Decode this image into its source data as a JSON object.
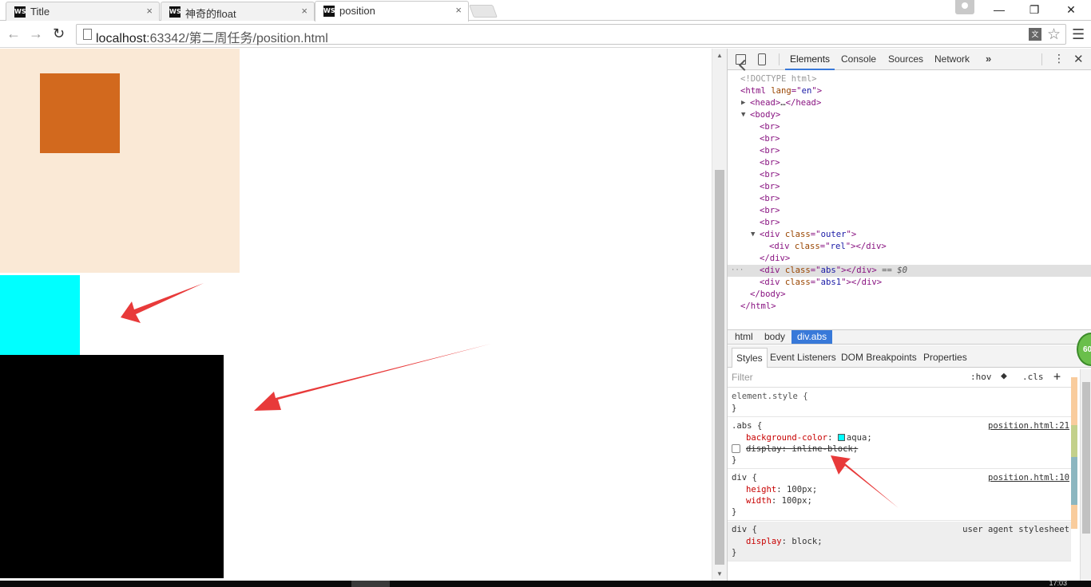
{
  "tabs": [
    {
      "title": "Title",
      "icon": "WS",
      "active": false
    },
    {
      "title": "神奇的float",
      "icon": "WS",
      "active": false
    },
    {
      "title": "position",
      "icon": "WS",
      "active": true
    }
  ],
  "tab_close": "×",
  "window_controls": {
    "minimize": "—",
    "restore": "❐",
    "close": "✕"
  },
  "address": {
    "host": "localhost",
    "path": ":63342/第二周任务/position.html"
  },
  "nav": {
    "back": "←",
    "forward": "→",
    "reload": "↻",
    "menu": "☰",
    "star": "☆",
    "translate": "文"
  },
  "page": {
    "colors": {
      "outer": "#fae9d6",
      "rel": "#d2691e",
      "abs": "#00ffff",
      "abs1": "#000000",
      "arrow": "#e83a3a"
    }
  },
  "devtools": {
    "tabs": [
      "Elements",
      "Console",
      "Sources",
      "Network"
    ],
    "more": "»",
    "kebab": "⋮",
    "close": "✕",
    "dom": [
      {
        "text": "<!DOCTYPE html>",
        "kind": "doctype",
        "indent": 0
      },
      {
        "tag": "html",
        "attrs": [
          [
            "lang",
            "en"
          ]
        ],
        "open_only": true,
        "indent": 0
      },
      {
        "tag": "head",
        "collapsed": true,
        "indent": 1,
        "tri": "▶"
      },
      {
        "tag": "body",
        "open_only": true,
        "indent": 1,
        "tri": "▼"
      },
      {
        "tag": "br",
        "open_only": true,
        "indent": 2
      },
      {
        "tag": "br",
        "open_only": true,
        "indent": 2
      },
      {
        "tag": "br",
        "open_only": true,
        "indent": 2
      },
      {
        "tag": "br",
        "open_only": true,
        "indent": 2
      },
      {
        "tag": "br",
        "open_only": true,
        "indent": 2
      },
      {
        "tag": "br",
        "open_only": true,
        "indent": 2
      },
      {
        "tag": "br",
        "open_only": true,
        "indent": 2
      },
      {
        "tag": "br",
        "open_only": true,
        "indent": 2
      },
      {
        "tag": "br",
        "open_only": true,
        "indent": 2
      },
      {
        "tag": "div",
        "attrs": [
          [
            "class",
            "outer"
          ]
        ],
        "open_only": true,
        "indent": 2,
        "tri": "▼"
      },
      {
        "tag": "div",
        "attrs": [
          [
            "class",
            "rel"
          ]
        ],
        "indent": 3
      },
      {
        "close": "div",
        "indent": 2
      },
      {
        "tag": "div",
        "attrs": [
          [
            "class",
            "abs"
          ]
        ],
        "indent": 2,
        "selected": true,
        "suffix": " == $0"
      },
      {
        "tag": "div",
        "attrs": [
          [
            "class",
            "abs1"
          ]
        ],
        "indent": 2
      },
      {
        "close": "body",
        "indent": 1
      },
      {
        "close": "html",
        "indent": 0
      }
    ],
    "breadcrumbs": [
      "html",
      "body",
      "div.abs"
    ],
    "subtabs": [
      "Styles",
      "Event Listeners",
      "DOM Breakpoints",
      "Properties"
    ],
    "filter_placeholder": "Filter",
    "hov": ":hov",
    "cls": ".cls",
    "plus": "+",
    "styles": {
      "element_style": {
        "selector": "element.style {",
        "close": "}"
      },
      "abs_rule": {
        "selector": ".abs {",
        "source": "position.html:21",
        "prop1_name": "background-color",
        "prop1_value": "aqua;",
        "prop2": "display: inline-block;",
        "close": "}"
      },
      "div_rule": {
        "selector": "div {",
        "source": "position.html:10",
        "prop1_name": "height",
        "prop1_value": "100px;",
        "prop2_name": "width",
        "prop2_value": "100px;",
        "close": "}"
      },
      "ua_rule": {
        "selector": "div {",
        "source": "user agent stylesheet",
        "prop1_name": "display",
        "prop1_value": "block;",
        "close": "}"
      }
    },
    "badge": "60"
  },
  "taskbar_clock": "17:03"
}
